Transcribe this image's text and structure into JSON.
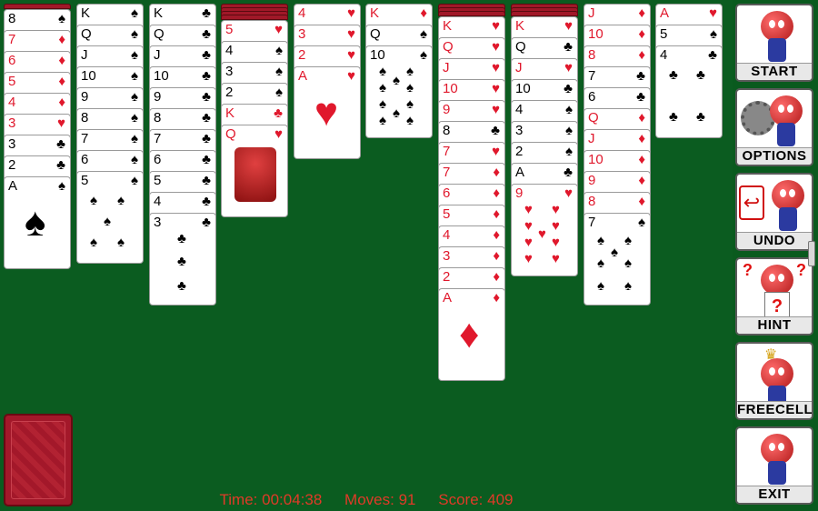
{
  "status": {
    "time_label": "Time:",
    "time_value": "00:04:38",
    "moves_label": "Moves:",
    "moves_value": "91",
    "score_label": "Score:",
    "score_value": "409"
  },
  "buttons": {
    "start": "START",
    "options": "OPTIONS",
    "undo": "UNDO",
    "hint": "HINT",
    "freecell": "FREECELL",
    "exit": "EXIT"
  },
  "columns": [
    {
      "backs": 1,
      "cards": [
        [
          "8",
          "♠",
          "blk"
        ],
        [
          "7",
          "♦",
          "red"
        ],
        [
          "6",
          "♦",
          "red"
        ],
        [
          "5",
          "♦",
          "red"
        ],
        [
          "4",
          "♦",
          "red"
        ],
        [
          "3",
          "♥",
          "red"
        ],
        [
          "3",
          "♣",
          "blk"
        ],
        [
          "2",
          "♣",
          "blk"
        ],
        [
          "A",
          "♠",
          "blk"
        ]
      ]
    },
    {
      "backs": 0,
      "cards": [
        [
          "K",
          "♠",
          "blk"
        ],
        [
          "Q",
          "♠",
          "blk"
        ],
        [
          "J",
          "♠",
          "blk"
        ],
        [
          "10",
          "♠",
          "blk"
        ],
        [
          "9",
          "♠",
          "blk"
        ],
        [
          "8",
          "♠",
          "blk"
        ],
        [
          "7",
          "♠",
          "blk"
        ],
        [
          "6",
          "♠",
          "blk"
        ],
        [
          "5",
          "♠",
          "blk"
        ]
      ]
    },
    {
      "backs": 0,
      "cards": [
        [
          "K",
          "♣",
          "blk"
        ],
        [
          "Q",
          "♣",
          "blk"
        ],
        [
          "J",
          "♣",
          "blk"
        ],
        [
          "10",
          "♣",
          "blk"
        ],
        [
          "9",
          "♣",
          "blk"
        ],
        [
          "8",
          "♣",
          "blk"
        ],
        [
          "7",
          "♣",
          "blk"
        ],
        [
          "6",
          "♣",
          "blk"
        ],
        [
          "5",
          "♣",
          "blk"
        ],
        [
          "4",
          "♣",
          "blk"
        ],
        [
          "3",
          "♣",
          "blk"
        ]
      ]
    },
    {
      "backs": 4,
      "cards": [
        [
          "5",
          "♥",
          "red"
        ],
        [
          "4",
          "♠",
          "blk"
        ],
        [
          "3",
          "♠",
          "blk"
        ],
        [
          "2",
          "♠",
          "blk"
        ],
        [
          "K",
          "♣",
          "red"
        ],
        [
          "Q",
          "♥",
          "red"
        ]
      ]
    },
    {
      "backs": 0,
      "cards": [
        [
          "4",
          "♥",
          "red"
        ],
        [
          "3",
          "♥",
          "red"
        ],
        [
          "2",
          "♥",
          "red"
        ],
        [
          "A",
          "♥",
          "red"
        ]
      ]
    },
    {
      "backs": 0,
      "cards": [
        [
          "K",
          "♦",
          "red"
        ],
        [
          "Q",
          "♠",
          "blk"
        ],
        [
          "10",
          "♠",
          "blk"
        ]
      ]
    },
    {
      "backs": 3,
      "cards": [
        [
          "K",
          "♥",
          "red"
        ],
        [
          "Q",
          "♥",
          "red"
        ],
        [
          "J",
          "♥",
          "red"
        ],
        [
          "10",
          "♥",
          "red"
        ],
        [
          "9",
          "♥",
          "red"
        ],
        [
          "8",
          "♣",
          "blk"
        ],
        [
          "7",
          "♥",
          "red"
        ],
        [
          "7",
          "♦",
          "red"
        ],
        [
          "6",
          "♦",
          "red"
        ],
        [
          "5",
          "♦",
          "red"
        ],
        [
          "4",
          "♦",
          "red"
        ],
        [
          "3",
          "♦",
          "red"
        ],
        [
          "2",
          "♦",
          "red"
        ],
        [
          "A",
          "♦",
          "red"
        ]
      ]
    },
    {
      "backs": 3,
      "cards": [
        [
          "K",
          "♥",
          "red"
        ],
        [
          "Q",
          "♣",
          "blk"
        ],
        [
          "J",
          "♥",
          "red"
        ],
        [
          "10",
          "♣",
          "blk"
        ],
        [
          "4",
          "♠",
          "blk"
        ],
        [
          "3",
          "♠",
          "blk"
        ],
        [
          "2",
          "♠",
          "blk"
        ],
        [
          "A",
          "♣",
          "blk"
        ],
        [
          "9",
          "♥",
          "red"
        ]
      ]
    },
    {
      "backs": 0,
      "cards": [
        [
          "J",
          "♦",
          "red"
        ],
        [
          "10",
          "♦",
          "red"
        ],
        [
          "8",
          "♦",
          "red"
        ],
        [
          "7",
          "♣",
          "blk"
        ],
        [
          "6",
          "♣",
          "blk"
        ],
        [
          "Q",
          "♦",
          "red"
        ],
        [
          "J",
          "♦",
          "red"
        ],
        [
          "10",
          "♦",
          "red"
        ],
        [
          "9",
          "♦",
          "red"
        ],
        [
          "8",
          "♦",
          "red"
        ],
        [
          "7",
          "♠",
          "blk"
        ]
      ]
    },
    {
      "backs": 0,
      "cards": [
        [
          "A",
          "♥",
          "red"
        ],
        [
          "5",
          "♠",
          "blk"
        ],
        [
          "4",
          "♣",
          "blk"
        ]
      ]
    }
  ]
}
